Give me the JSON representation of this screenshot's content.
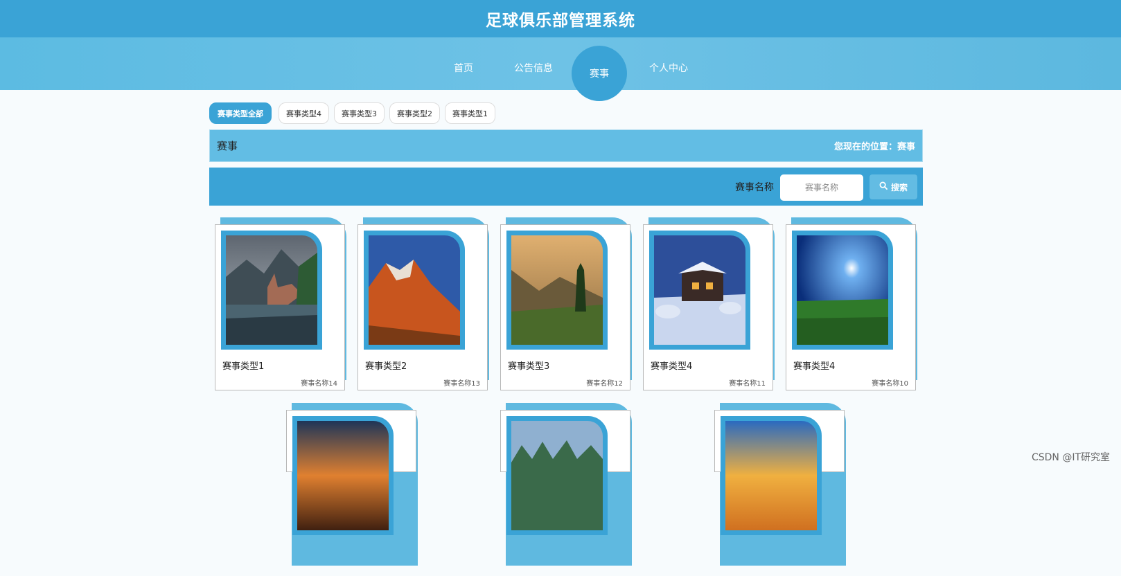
{
  "header": {
    "title": "足球俱乐部管理系统"
  },
  "nav": {
    "items": [
      {
        "label": "首页"
      },
      {
        "label": "公告信息"
      },
      {
        "label": "赛事"
      },
      {
        "label": "个人中心"
      }
    ]
  },
  "type_filters": [
    {
      "label": "赛事类型全部"
    },
    {
      "label": "赛事类型4"
    },
    {
      "label": "赛事类型3"
    },
    {
      "label": "赛事类型2"
    },
    {
      "label": "赛事类型1"
    }
  ],
  "breadcrumb": {
    "title": "赛事",
    "position": "您现在的位置：赛事"
  },
  "search": {
    "label": "赛事名称",
    "placeholder": "赛事名称",
    "button": "搜索"
  },
  "cards": [
    {
      "type": "赛事类型1",
      "name": "赛事名称14"
    },
    {
      "type": "赛事类型2",
      "name": "赛事名称13"
    },
    {
      "type": "赛事类型3",
      "name": "赛事名称12"
    },
    {
      "type": "赛事类型4",
      "name": "赛事名称11"
    },
    {
      "type": "赛事类型4",
      "name": "赛事名称10"
    }
  ],
  "watermark": "CSDN @IT研究室",
  "colors": {
    "primary": "#3aa3d6",
    "light": "#62bde4"
  }
}
